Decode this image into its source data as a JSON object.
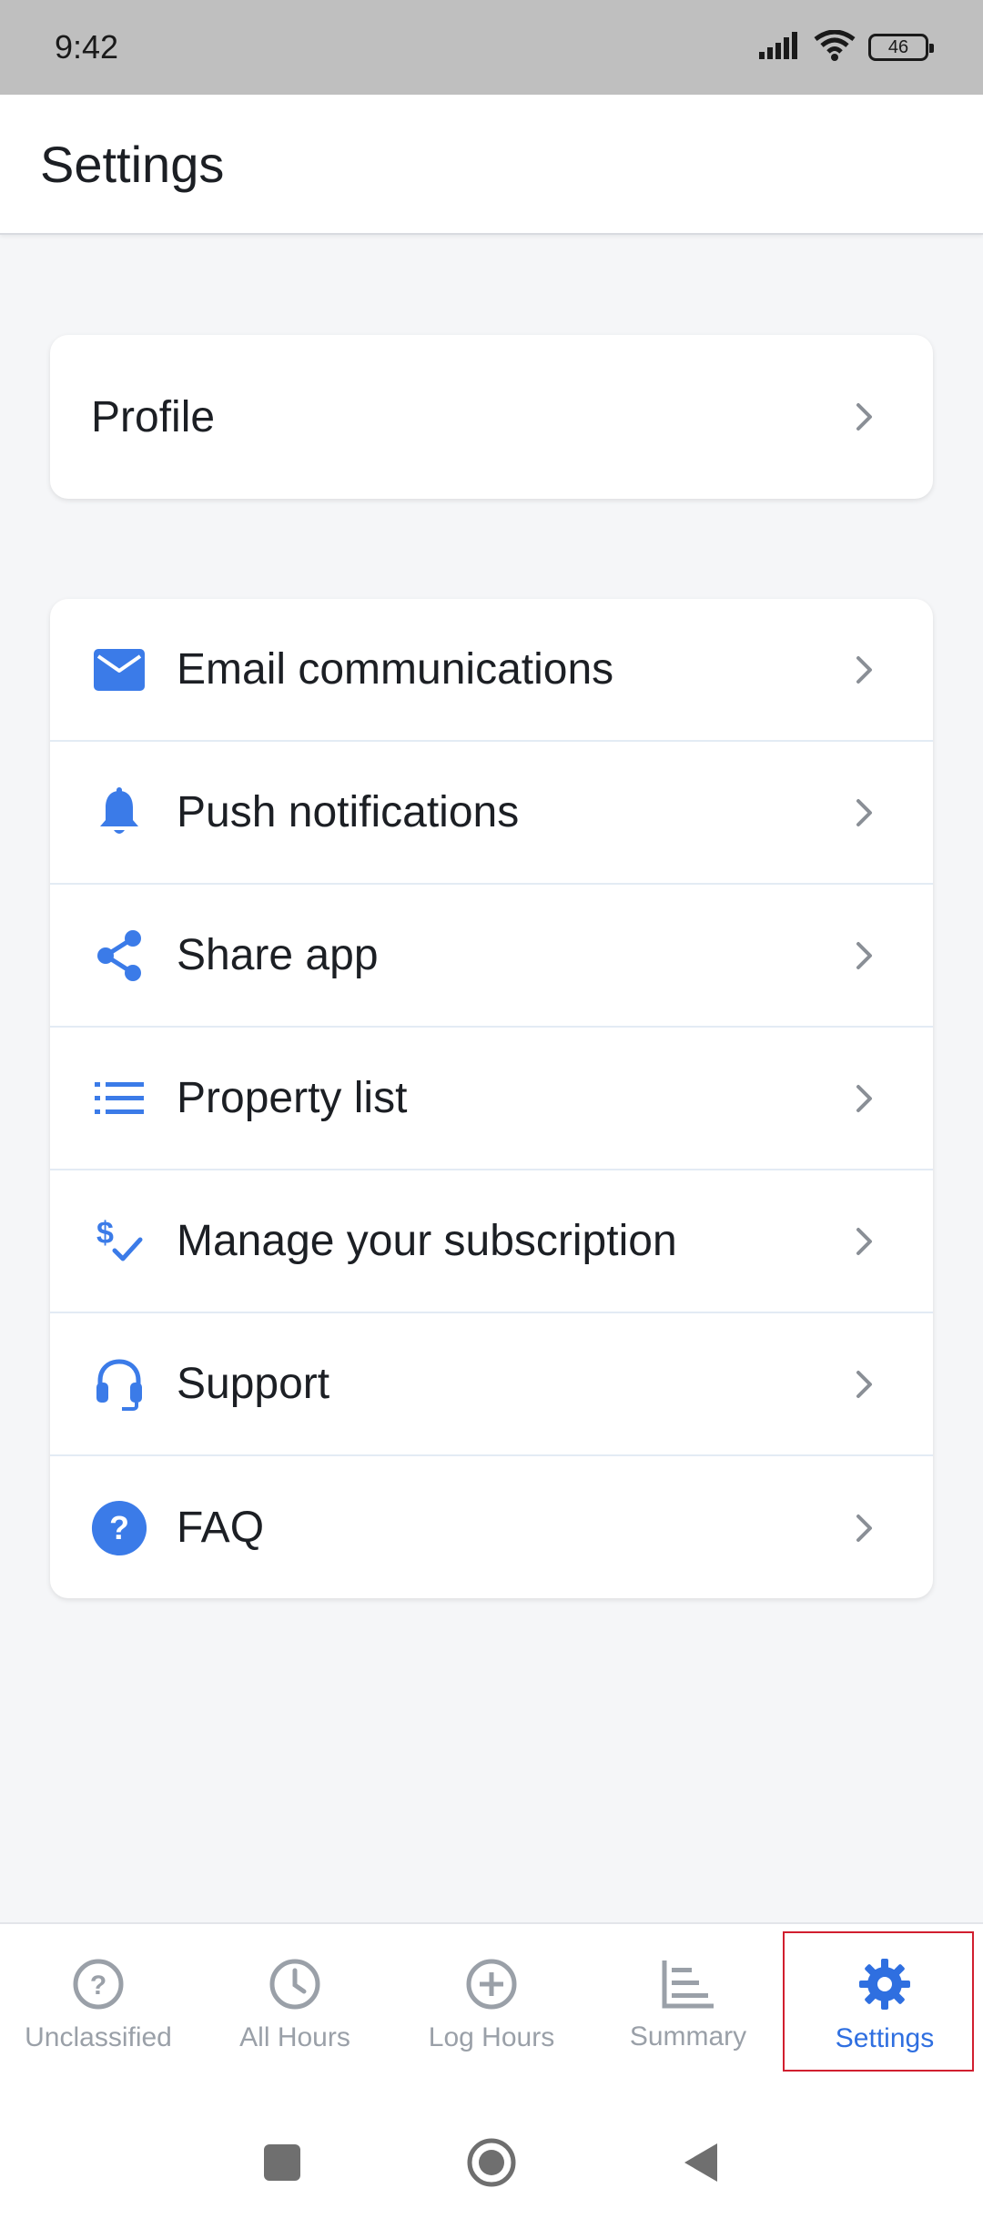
{
  "status_bar": {
    "time": "9:42",
    "battery": "46"
  },
  "header": {
    "title": "Settings"
  },
  "profile": {
    "label": "Profile"
  },
  "menu": [
    {
      "label": "Email communications",
      "icon": "mail-icon"
    },
    {
      "label": "Push notifications",
      "icon": "bell-icon"
    },
    {
      "label": "Share app",
      "icon": "share-icon"
    },
    {
      "label": "Property list",
      "icon": "list-icon"
    },
    {
      "label": "Manage your subscription",
      "icon": "subscription-icon"
    },
    {
      "label": "Support",
      "icon": "headset-icon"
    },
    {
      "label": "FAQ",
      "icon": "help-icon"
    }
  ],
  "bottom_nav": [
    {
      "label": "Unclassified",
      "icon": "question-circle-icon",
      "active": false
    },
    {
      "label": "All Hours",
      "icon": "clock-icon",
      "active": false
    },
    {
      "label": "Log Hours",
      "icon": "plus-circle-icon",
      "active": false
    },
    {
      "label": "Summary",
      "icon": "summary-chart-icon",
      "active": false
    },
    {
      "label": "Settings",
      "icon": "gear-icon",
      "active": true
    }
  ],
  "colors": {
    "accent": "#3b7be8",
    "inactive": "#9aa0a8",
    "highlight": "#d11f2f"
  }
}
